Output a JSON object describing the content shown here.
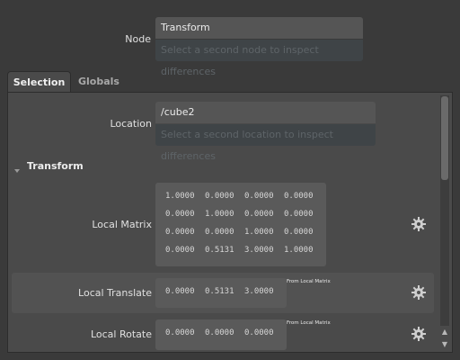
{
  "node": {
    "label": "Node",
    "value": "Transform",
    "placeholder": "Select a second node to inspect differences"
  },
  "tabs": [
    {
      "label": "Selection",
      "active": true
    },
    {
      "label": "Globals",
      "active": false
    }
  ],
  "location": {
    "label": "Location",
    "value": "/cube2",
    "placeholder": "Select a second location to inspect differences"
  },
  "transform_section": {
    "title": "Transform",
    "expander_icon": "triangle-down-icon"
  },
  "local_matrix": {
    "label": "Local Matrix",
    "rows": [
      [
        "1.0000",
        "0.0000",
        "0.0000",
        "0.0000"
      ],
      [
        "0.0000",
        "1.0000",
        "0.0000",
        "0.0000"
      ],
      [
        "0.0000",
        "0.0000",
        "1.0000",
        "0.0000"
      ],
      [
        "0.0000",
        "0.5131",
        "3.0000",
        "1.0000"
      ]
    ]
  },
  "local_translate": {
    "label": "Local Translate",
    "values": [
      "0.0000",
      "0.5131",
      "3.0000"
    ],
    "source": "From Local Matrix"
  },
  "local_rotate": {
    "label": "Local Rotate",
    "values": [
      "0.0000",
      "0.0000",
      "0.0000"
    ],
    "source": "From Local Matrix"
  },
  "icons": {
    "gear": "gear-icon",
    "scroll_up": "scroll-up-arrow-icon",
    "scroll_down": "scroll-down-arrow-icon"
  },
  "colors": {
    "background": "#3a3a3a",
    "panel": "#4a4a4a",
    "field": "#555555",
    "placeholder_field": "#3f4447"
  }
}
